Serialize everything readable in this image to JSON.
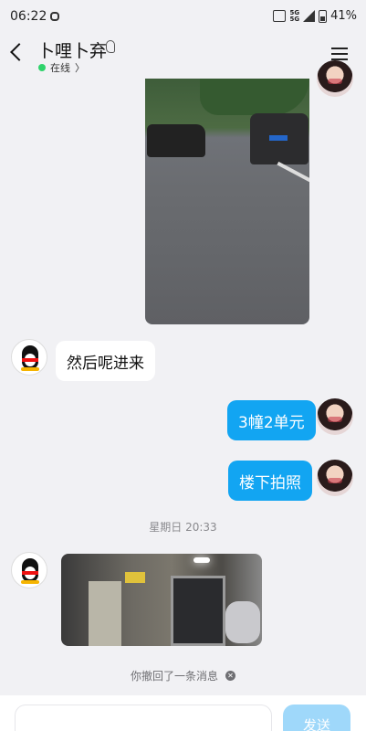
{
  "status_bar": {
    "time": "06:22",
    "network_top": "5G",
    "network_bottom": "5G",
    "battery": "41%"
  },
  "header": {
    "title": "卜哩卜弃",
    "status": "在线",
    "status_chevron": "〉"
  },
  "messages": [
    {
      "type": "image",
      "side": "right",
      "description_icon": "street-photo"
    },
    {
      "type": "text",
      "side": "left",
      "text": "然后呢进来"
    },
    {
      "type": "text",
      "side": "right",
      "text": "3幢2单元"
    },
    {
      "type": "text",
      "side": "right",
      "text": "楼下拍照"
    },
    {
      "type": "time",
      "text": "星期日 20:33"
    },
    {
      "type": "image",
      "side": "left",
      "description_icon": "doorway-photo"
    },
    {
      "type": "system",
      "text": "你撤回了一条消息"
    }
  ],
  "input": {
    "placeholder": "",
    "send_label": "发送"
  },
  "colors": {
    "accent": "#12a5f2",
    "online": "#2fd36b",
    "background": "#f1f1f4"
  }
}
